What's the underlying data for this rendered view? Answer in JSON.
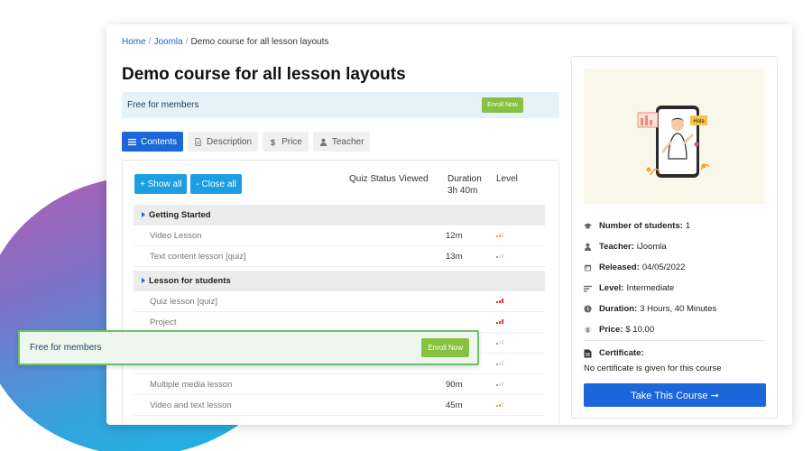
{
  "breadcrumb": {
    "items": [
      "Home",
      "Joomla",
      "Demo course for all lesson layouts"
    ],
    "separator": "/"
  },
  "page_title": "Demo course for all lesson layouts",
  "enroll_bar": {
    "text": "Free for members",
    "button_label": "Enroll Now"
  },
  "tabs": [
    {
      "label": "Contents",
      "icon": "list-icon",
      "active": true
    },
    {
      "label": "Description",
      "icon": "document-icon",
      "active": false
    },
    {
      "label": "Price",
      "icon": "dollar-icon",
      "active": false
    },
    {
      "label": "Teacher",
      "icon": "user-icon",
      "active": false
    }
  ],
  "contents": {
    "show_all_label": "+ Show all",
    "close_all_label": "- Close all",
    "columns": {
      "quiz_status": "Quiz Status",
      "viewed": "Viewed",
      "duration": "Duration",
      "duration_total": "3h 40m",
      "level": "Level"
    },
    "rows": [
      {
        "type": "section",
        "title": "Getting Started"
      },
      {
        "type": "lesson",
        "title": "Video Lesson",
        "duration": "12m",
        "level": 2
      },
      {
        "type": "lesson",
        "title": "Text content lesson [quiz]",
        "duration": "13m",
        "level": 1
      },
      {
        "type": "section",
        "title": "Lesson for students"
      },
      {
        "type": "lesson",
        "title": "Quiz lesson [quiz]",
        "duration": "",
        "level": 3
      },
      {
        "type": "lesson",
        "title": "Project",
        "duration": "",
        "level": 3
      },
      {
        "type": "lesson",
        "title": "",
        "duration": "",
        "level": 1
      },
      {
        "type": "lesson",
        "title": "",
        "duration": "",
        "level": 1
      },
      {
        "type": "lesson",
        "title": "Multiple media lesson",
        "duration": "90m",
        "level": 1
      },
      {
        "type": "lesson",
        "title": "Video and text lesson",
        "duration": "45m",
        "level": 2
      }
    ]
  },
  "floating_bar": {
    "text": "Free for members",
    "button_label": "Enroll Now"
  },
  "sidebar": {
    "illustration_bubble": "Hola",
    "info": [
      {
        "icon": "graduation-cap-icon",
        "label": "Number of students:",
        "value": "1"
      },
      {
        "icon": "user-icon",
        "label": "Teacher:",
        "value": "iJoomla"
      },
      {
        "icon": "calendar-icon",
        "label": "Released:",
        "value": "04/05/2022"
      },
      {
        "icon": "level-icon",
        "label": "Level:",
        "value": "Intermediate"
      },
      {
        "icon": "clock-icon",
        "label": "Duration:",
        "value": "3 Hours, 40 Minutes"
      },
      {
        "icon": "dollar-icon",
        "label": "Price:",
        "value": "$ 10.00"
      }
    ],
    "certificate_title": "Certificate:",
    "certificate_text": "No certificate is given for this course",
    "take_course_label": "Take This Course ➞"
  },
  "colors": {
    "primary": "#1b66d8",
    "enroll_green": "#86c140",
    "show_close_blue": "#1b9fe2",
    "level_easy": "#f3a21b",
    "level_medium": "#7bc244",
    "level_hard": "#e52d2d"
  }
}
